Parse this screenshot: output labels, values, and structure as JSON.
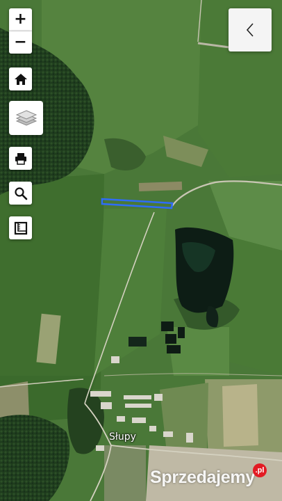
{
  "map": {
    "place_label": "Słupy",
    "basemap": "satellite"
  },
  "controls": {
    "zoom_in_label": "+",
    "zoom_out_label": "−",
    "home_icon": "home-icon",
    "layers_icon": "layers-icon",
    "print_icon": "printer-icon",
    "search_icon": "search-icon",
    "measure_icon": "ruler-icon",
    "collapse_icon": "chevron-left-icon"
  },
  "parcel": {
    "highlight_color": "#2f6df5"
  },
  "watermark": {
    "text": "Sprzedajemy",
    "suffix": ".pl",
    "accent_color": "#e21b23"
  }
}
